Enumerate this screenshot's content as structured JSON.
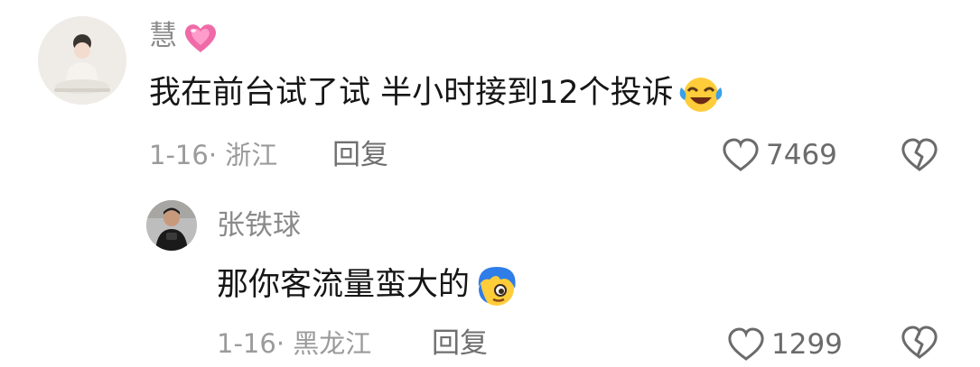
{
  "comments": [
    {
      "username": "慧",
      "username_badge_icon": "pink-heart-icon",
      "text": "我在前台试了试 半小时接到12个投诉",
      "emoji_icon": "laughing-crying-emoji-icon",
      "meta": "1-16· 浙江",
      "reply_label": "回复",
      "like_count": "7469"
    },
    {
      "username": "张铁球",
      "text": "那你客流量蛮大的",
      "emoji_icon": "blue-hair-peeking-emoji-icon",
      "meta": "1-16· 黑龙江",
      "reply_label": "回复",
      "like_count": "1299"
    }
  ],
  "colors": {
    "username": "#8a8a8a",
    "text": "#161616",
    "meta": "#9b9b9b",
    "icon": "#6b6b6b"
  }
}
